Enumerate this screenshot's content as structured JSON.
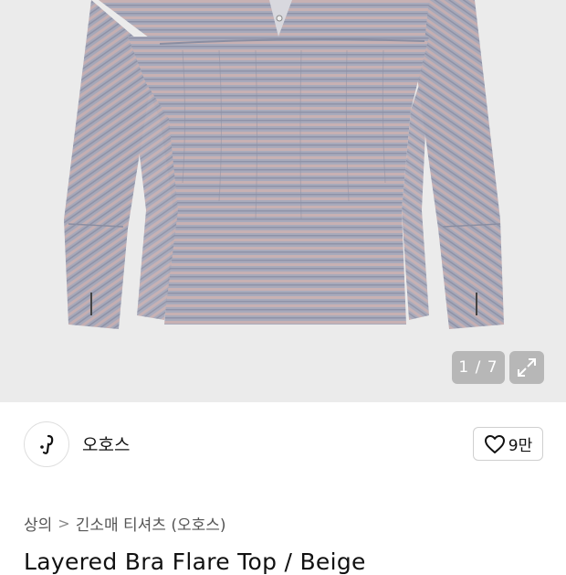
{
  "gallery": {
    "counter": "1 / 7",
    "expand_icon": "expand-icon",
    "stripe_colors": [
      "#a7a9ba",
      "#c4aeb0",
      "#9da0b3"
    ]
  },
  "brand": {
    "name": "오호스",
    "logo_icon": "brand-logo-icon"
  },
  "like": {
    "icon": "heart-icon",
    "count": "9만"
  },
  "breadcrumb": {
    "category": "상의",
    "separator": ">",
    "subcategory": "긴소매 티셔츠 (오호스)"
  },
  "product": {
    "title": "Layered Bra Flare Top / Beige"
  }
}
